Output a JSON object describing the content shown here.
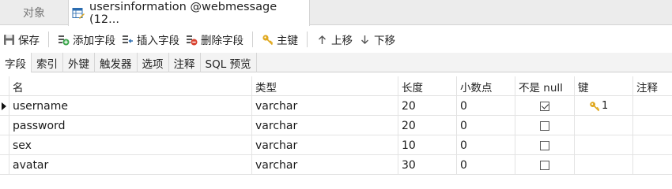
{
  "tabs": {
    "objects_label": "对象",
    "active_label": "usersinformation @webmessage (12..."
  },
  "toolbar": {
    "save": "保存",
    "add_field": "添加字段",
    "insert_field": "插入字段",
    "delete_field": "删除字段",
    "primary_key": "主键",
    "move_up": "上移",
    "move_down": "下移"
  },
  "subtabs": [
    "字段",
    "索引",
    "外键",
    "触发器",
    "选项",
    "注释",
    "SQL 预览"
  ],
  "columns": {
    "name": "名",
    "type": "类型",
    "length": "长度",
    "decimals": "小数点",
    "not_null": "不是 null",
    "key": "键",
    "comment": "注释"
  },
  "rows": [
    {
      "name": "username",
      "type": "varchar",
      "length": "20",
      "decimals": "0",
      "not_null": true,
      "key": "1",
      "selected": true
    },
    {
      "name": "password",
      "type": "varchar",
      "length": "20",
      "decimals": "0",
      "not_null": false,
      "key": "",
      "selected": false
    },
    {
      "name": "sex",
      "type": "varchar",
      "length": "10",
      "decimals": "0",
      "not_null": false,
      "key": "",
      "selected": false
    },
    {
      "name": "avatar",
      "type": "varchar",
      "length": "30",
      "decimals": "0",
      "not_null": false,
      "key": "",
      "selected": false
    }
  ],
  "icons": {
    "table_tab": "table-design-icon",
    "save": "save-icon",
    "add_field": "add-field-icon",
    "insert_field": "insert-field-icon",
    "delete_field": "delete-field-icon",
    "primary_key": "key-icon",
    "move_up": "arrow-up-icon",
    "move_down": "arrow-down-icon"
  },
  "colors": {
    "key_gold": "#e0a81e",
    "add_green": "#3aa64a",
    "delete_red": "#d9412f",
    "tab_blue": "#2b6cb0"
  }
}
